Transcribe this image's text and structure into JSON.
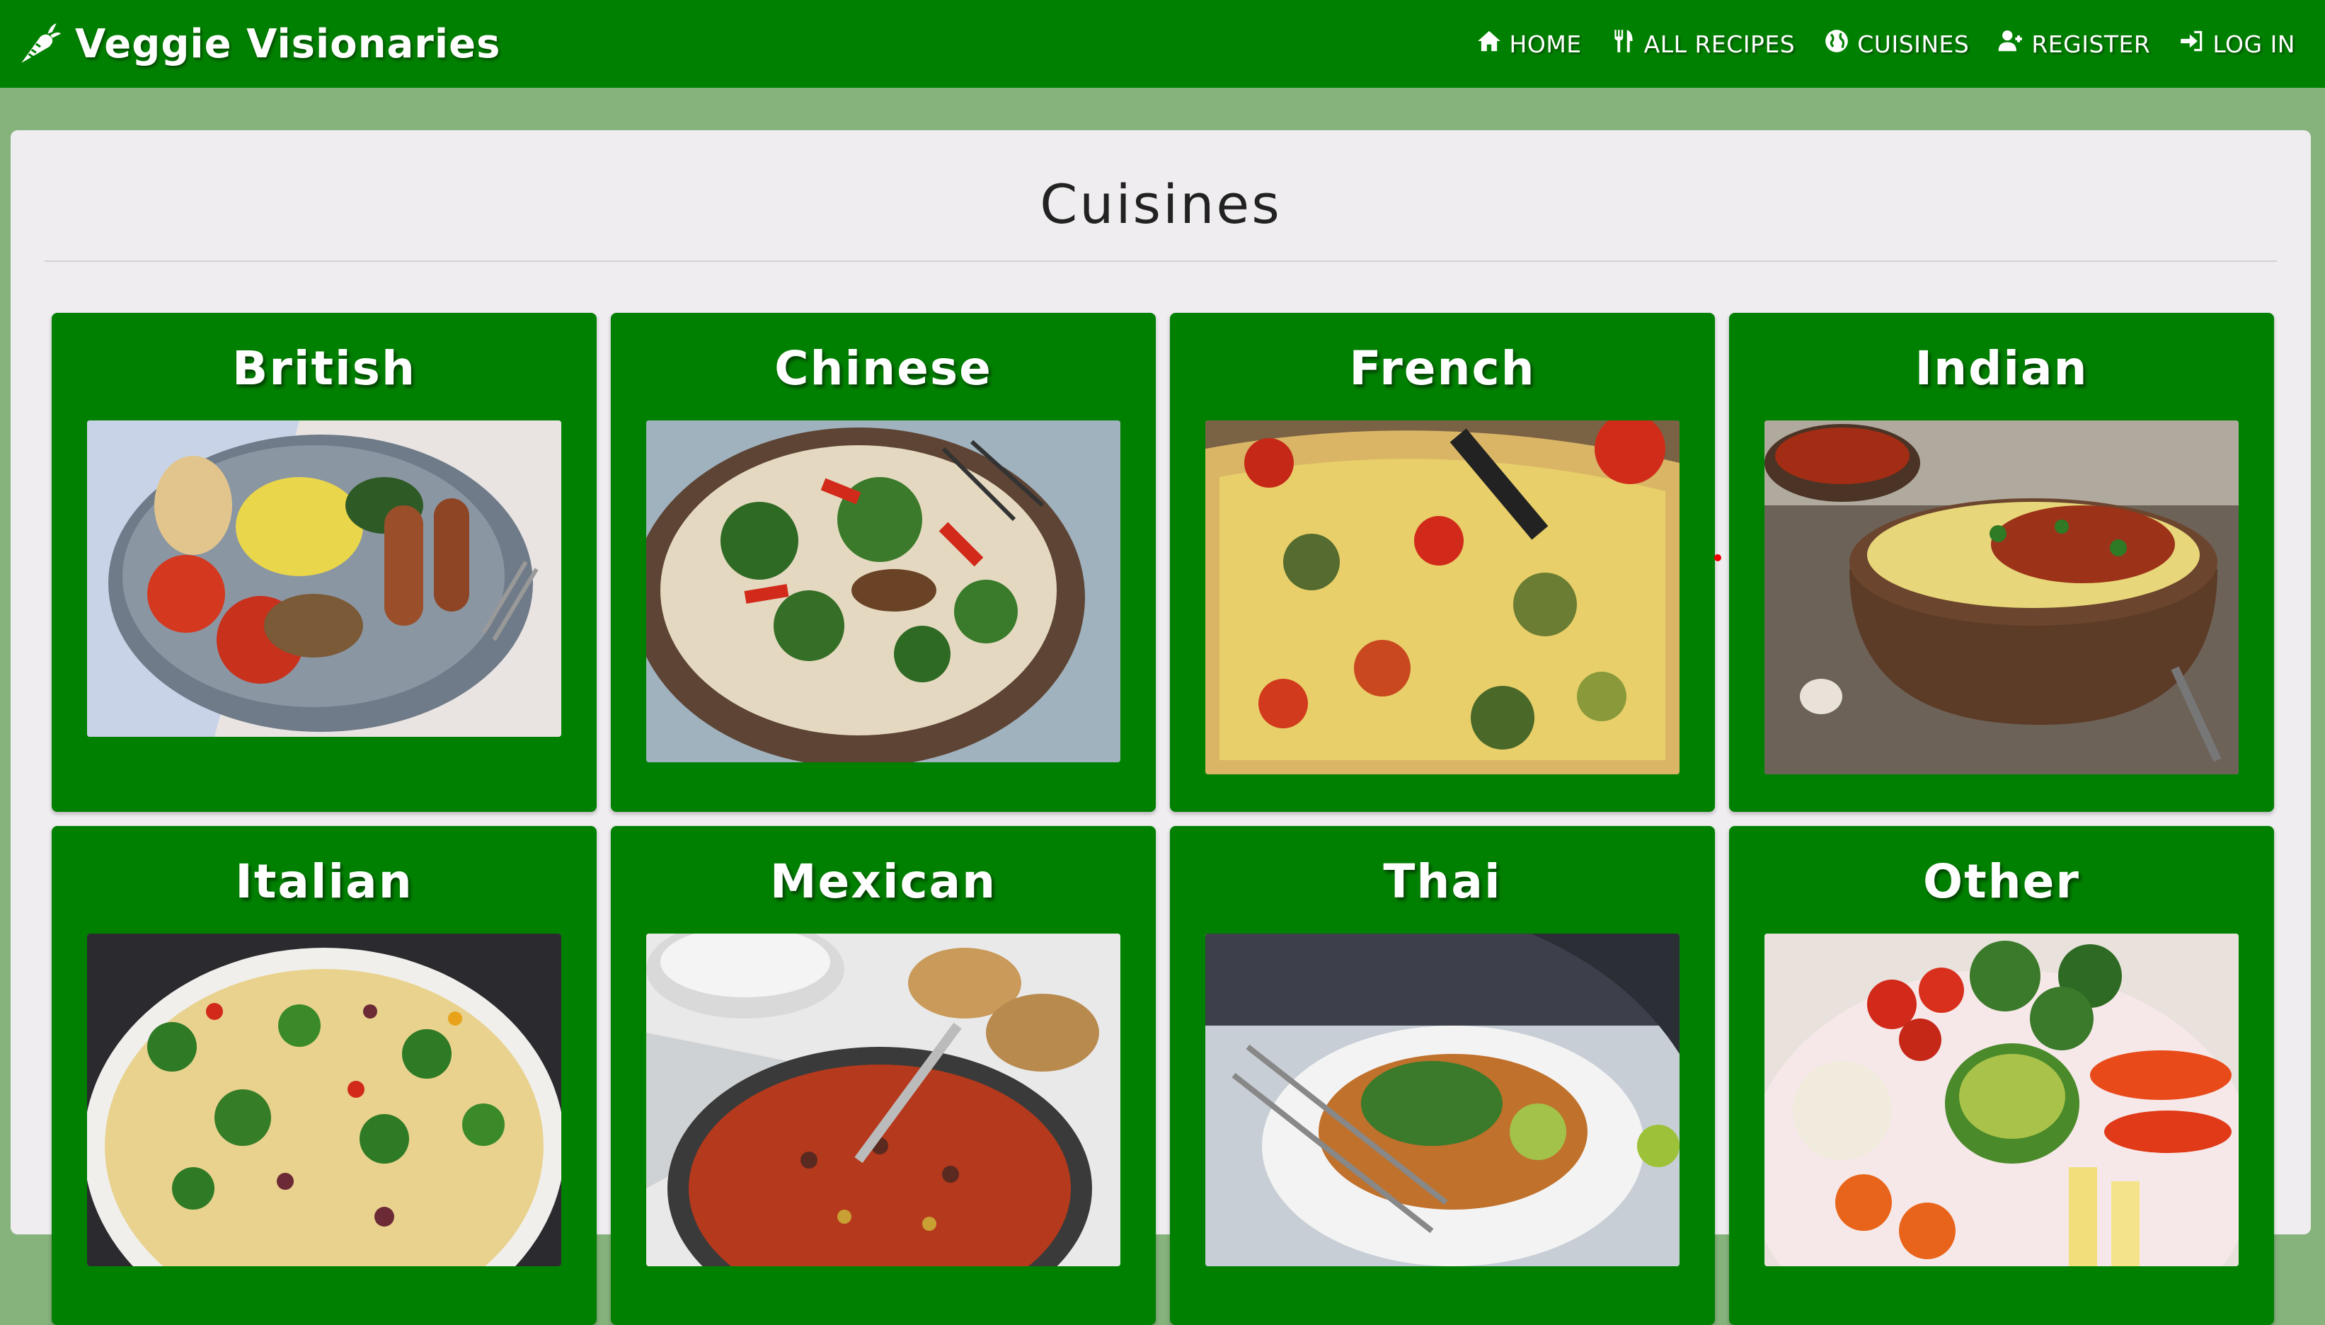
{
  "brand": {
    "name": "Veggie Visionaries",
    "icon": "carrot-icon"
  },
  "nav": [
    {
      "label": "HOME",
      "icon": "home-icon"
    },
    {
      "label": "ALL RECIPES",
      "icon": "utensils-icon"
    },
    {
      "label": "CUISINES",
      "icon": "globe-icon"
    },
    {
      "label": "REGISTER",
      "icon": "user-plus-icon"
    },
    {
      "label": "LOG IN",
      "icon": "sign-in-icon"
    }
  ],
  "page": {
    "title": "Cuisines"
  },
  "cuisines": [
    {
      "name": "British"
    },
    {
      "name": "Chinese"
    },
    {
      "name": "French"
    },
    {
      "name": "Indian"
    },
    {
      "name": "Italian"
    },
    {
      "name": "Mexican"
    },
    {
      "name": "Thai"
    },
    {
      "name": "Other"
    }
  ],
  "colors": {
    "nav_bg": "#008000",
    "page_bg": "#86b27c",
    "panel_bg": "#efedf0",
    "card_bg": "#008000"
  }
}
